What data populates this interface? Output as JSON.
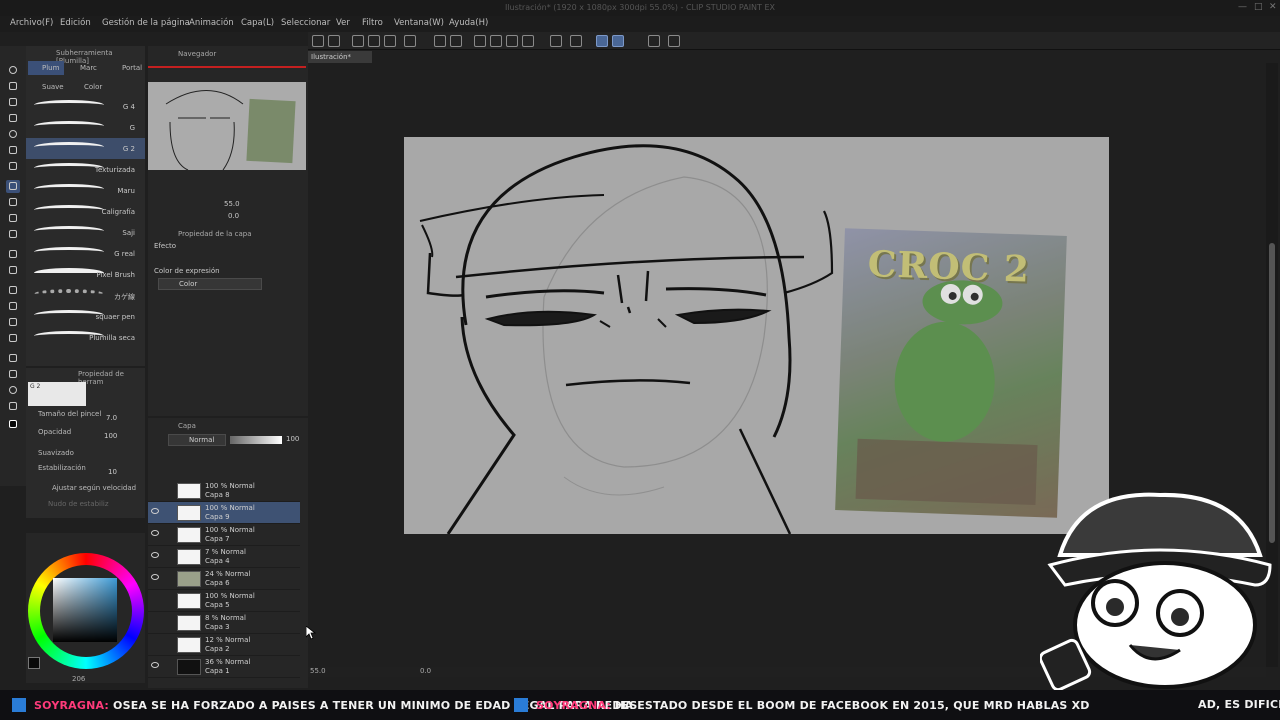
{
  "app": {
    "title": "Ilustración* (1920 x 1080px 300dpi 55.0%)  - CLIP STUDIO PAINT EX"
  },
  "menu": [
    "Archivo(F)",
    "Edición",
    "Gestión de la página",
    "Animación",
    "Capa(L)",
    "Seleccionar",
    "Ver",
    "Filtro",
    "Ventana(W)",
    "Ayuda(H)"
  ],
  "subtool": {
    "header": "Subherramienta [Plumilla]",
    "tabs": [
      "Plum",
      "Marc",
      "Portal"
    ],
    "subtabs": [
      "Suave",
      "Color"
    ],
    "brushes": [
      "G 4",
      "G",
      "G 2",
      "Texturizada",
      "Maru",
      "Caligrafía",
      "Saji",
      "G real",
      "Pixel Brush",
      "カゲ線",
      "squaer pen",
      "Plumilla seca"
    ],
    "selected_index": 2
  },
  "tool_property": {
    "header": "Propiedad de herram",
    "preset": "G 2",
    "brush_size_label": "Tamaño del pincel",
    "brush_size_value": "7.0",
    "opacity_label": "Opacidad",
    "opacity_value": "100",
    "smoothing_label": "Suavizado",
    "stabilization_label": "Estabilización",
    "stabilization_value": "10",
    "speed_label": "Ajustar según velocidad",
    "border_label": "Nudo de estabiliz"
  },
  "color": {
    "main": "#0a0a0a",
    "sub": "#ffffff",
    "hue": "#3d9bd6",
    "hsv_readout": "206"
  },
  "navigator": {
    "header": "Navegador",
    "zoom": "55.0",
    "rotation": "0.0"
  },
  "layer_property": {
    "header": "Propiedad de la capa",
    "effect_label": "Efecto",
    "expression_label": "Color de expresión",
    "expression_value": "Color"
  },
  "layers": {
    "header": "Capa",
    "blend_mode": "Normal",
    "opacity": "100",
    "items": [
      {
        "mode": "100 % Normal",
        "name": "Capa 8",
        "visible": false,
        "selected": false,
        "dark": false
      },
      {
        "mode": "100 % Normal",
        "name": "Capa 9",
        "visible": true,
        "selected": true,
        "dark": false
      },
      {
        "mode": "100 % Normal",
        "name": "Capa 7",
        "visible": true,
        "selected": false,
        "dark": false
      },
      {
        "mode": "7 % Normal",
        "name": "Capa 4",
        "visible": true,
        "selected": false,
        "dark": false
      },
      {
        "mode": "24 % Normal",
        "name": "Capa 6",
        "visible": true,
        "selected": false,
        "dark": false
      },
      {
        "mode": "100 % Normal",
        "name": "Capa 5",
        "visible": false,
        "selected": false,
        "dark": false
      },
      {
        "mode": "8 % Normal",
        "name": "Capa 3",
        "visible": false,
        "selected": false,
        "dark": false
      },
      {
        "mode": "12 % Normal",
        "name": "Capa 2",
        "visible": false,
        "selected": false,
        "dark": false
      },
      {
        "mode": "36 % Normal",
        "name": "Capa 1",
        "visible": true,
        "selected": false,
        "dark": true
      }
    ]
  },
  "canvas": {
    "tab": "Ilustración*",
    "reference_title": "CROC 2",
    "status_zoom": "55.0",
    "status_rotation": "0.0"
  },
  "chat_ticker": [
    {
      "user": "SoyRagna:",
      "text": "osea se ha forzado a paises a tener un minimo de edad legal para redes"
    },
    {
      "user": "SoyRagna:",
      "text": "ha estado desde el boom de facebook en 2015, que mrd hablas XD"
    },
    {
      "user": "",
      "text": "ad, es dificil in"
    }
  ]
}
